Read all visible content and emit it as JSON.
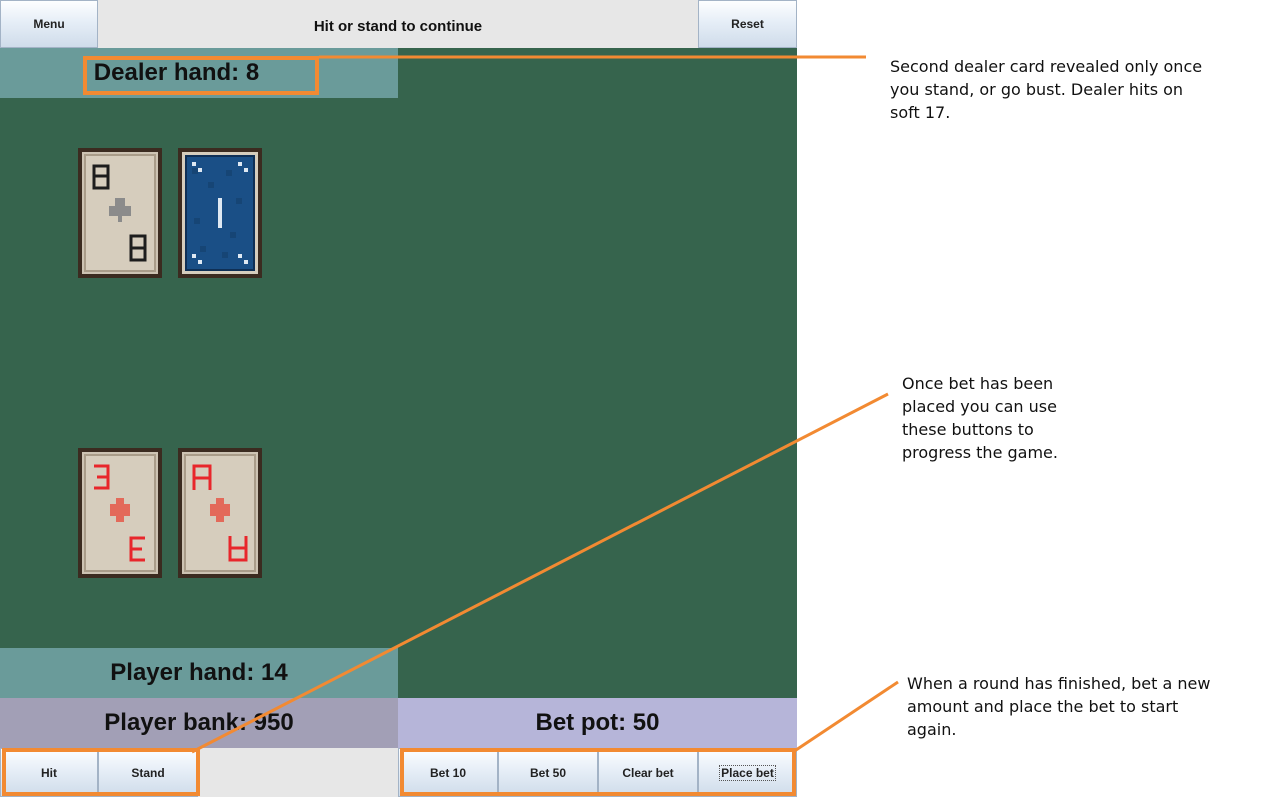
{
  "toolbar": {
    "menu_label": "Menu",
    "status_text": "Hit or stand to continue",
    "reset_label": "Reset"
  },
  "dealer": {
    "hand_text": "Dealer hand: 8",
    "cards": [
      {
        "rank": "8",
        "suit": "clubs",
        "face": "up"
      },
      {
        "rank": "",
        "suit": "",
        "face": "down"
      }
    ]
  },
  "player": {
    "hand_text": "Player hand: 14",
    "bank_text": "Player bank: 950",
    "cards": [
      {
        "rank": "3",
        "suit": "diamonds",
        "face": "up"
      },
      {
        "rank": "A",
        "suit": "diamonds",
        "face": "up"
      }
    ]
  },
  "bet": {
    "pot_text": "Bet pot: 50"
  },
  "actions": {
    "hit_label": "Hit",
    "stand_label": "Stand"
  },
  "betting": {
    "bet10_label": "Bet 10",
    "bet50_label": "Bet 50",
    "clear_label": "Clear bet",
    "place_label": "Place bet"
  },
  "annotations": {
    "dealer_note": "Second dealer card revealed only once\nyou stand, or go bust. Dealer hits on\nsoft 17.",
    "actions_note": "Once bet has been\nplaced you can use\nthese buttons to\nprogress the game.",
    "betting_note": "When a round has finished, bet a new\namount and place the bet to start\nagain."
  },
  "colors": {
    "felt": "#36644d",
    "highlight": "#f28a32",
    "red_suit": "#e8262b",
    "card_back": "#1a4f86"
  }
}
